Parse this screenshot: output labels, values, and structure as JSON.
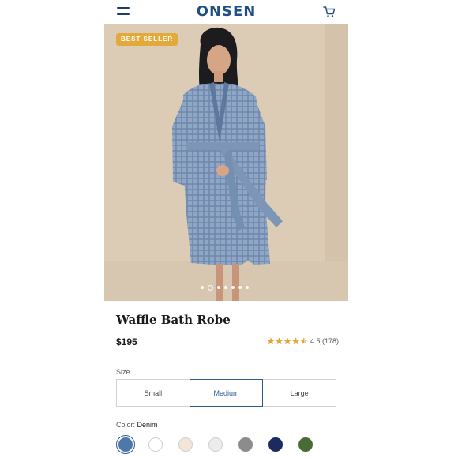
{
  "header": {
    "brand": "ONSEN",
    "menu_icon": "hamburger-menu-icon",
    "cart_icon": "shopping-cart-icon",
    "brand_color": "#1f4f84"
  },
  "hero": {
    "badge": "BEST SELLER",
    "badge_color": "#e3a93a",
    "carousel": {
      "total_slides": 7,
      "active_index": 1
    }
  },
  "product": {
    "title": "Waffle Bath Robe",
    "price": "$195",
    "rating": {
      "value": 4.5,
      "max": 5,
      "text": "4.5 (178)",
      "star_color": "#e0a83a"
    }
  },
  "size": {
    "label": "Size",
    "options": [
      "Small",
      "Medium",
      "Large"
    ],
    "selected": "Medium"
  },
  "color": {
    "label": "Color:",
    "selected_name": "Denim",
    "swatches": [
      {
        "hex": "#4f77a8",
        "selected": true
      },
      {
        "hex": "#ffffff",
        "selected": false
      },
      {
        "hex": "#f3e6d8",
        "selected": false
      },
      {
        "hex": "#ececec",
        "selected": false
      },
      {
        "hex": "#8c8c8c",
        "selected": false
      },
      {
        "hex": "#1c2a5e",
        "selected": false
      },
      {
        "hex": "#4a6b34",
        "selected": false
      }
    ],
    "accent": "#2b5b94"
  }
}
